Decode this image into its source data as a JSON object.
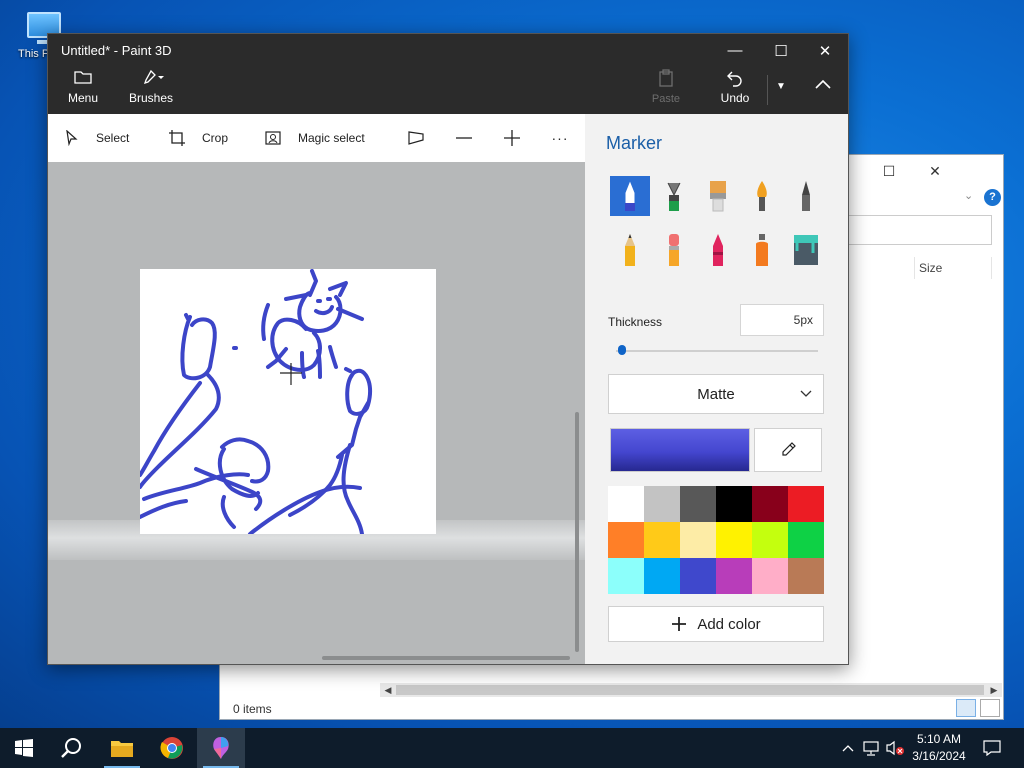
{
  "desktop": {
    "icon_label": "This PC"
  },
  "explorer": {
    "column_size": "Size",
    "status": "0 items"
  },
  "paint": {
    "title": "Untitled* - Paint 3D",
    "ribbon": {
      "menu": "Menu",
      "brushes": "Brushes",
      "paste": "Paste",
      "undo": "Undo"
    },
    "toolbar": {
      "select": "Select",
      "crop": "Crop",
      "magic_select": "Magic select",
      "more": "···"
    },
    "panel": {
      "title": "Marker",
      "brushes": [
        {
          "name": "marker",
          "selected": true
        },
        {
          "name": "calligraphy-pen",
          "selected": false
        },
        {
          "name": "oil-brush",
          "selected": false
        },
        {
          "name": "watercolor",
          "selected": false
        },
        {
          "name": "pixel-pen",
          "selected": false
        },
        {
          "name": "pencil",
          "selected": false
        },
        {
          "name": "eraser",
          "selected": false
        },
        {
          "name": "crayon",
          "selected": false
        },
        {
          "name": "spray-can",
          "selected": false
        },
        {
          "name": "fill-bucket",
          "selected": false
        }
      ],
      "thickness_label": "Thickness",
      "thickness_value": "5px",
      "thickness_fraction": 0.01,
      "finish": "Matte",
      "current_color": "#4446cf",
      "palette": [
        "#ffffff",
        "#c3c3c3",
        "#585858",
        "#000000",
        "#88001b",
        "#ec1c24",
        "#ff7f27",
        "#ffca18",
        "#fdeca6",
        "#fff200",
        "#c4ff0e",
        "#0ed145",
        "#8cfffb",
        "#00a8f3",
        "#3f48cc",
        "#b83dba",
        "#ffaec8",
        "#b97a56"
      ],
      "add_color": "Add color"
    }
  },
  "taskbar": {
    "time": "5:10 AM",
    "date": "3/16/2024"
  }
}
